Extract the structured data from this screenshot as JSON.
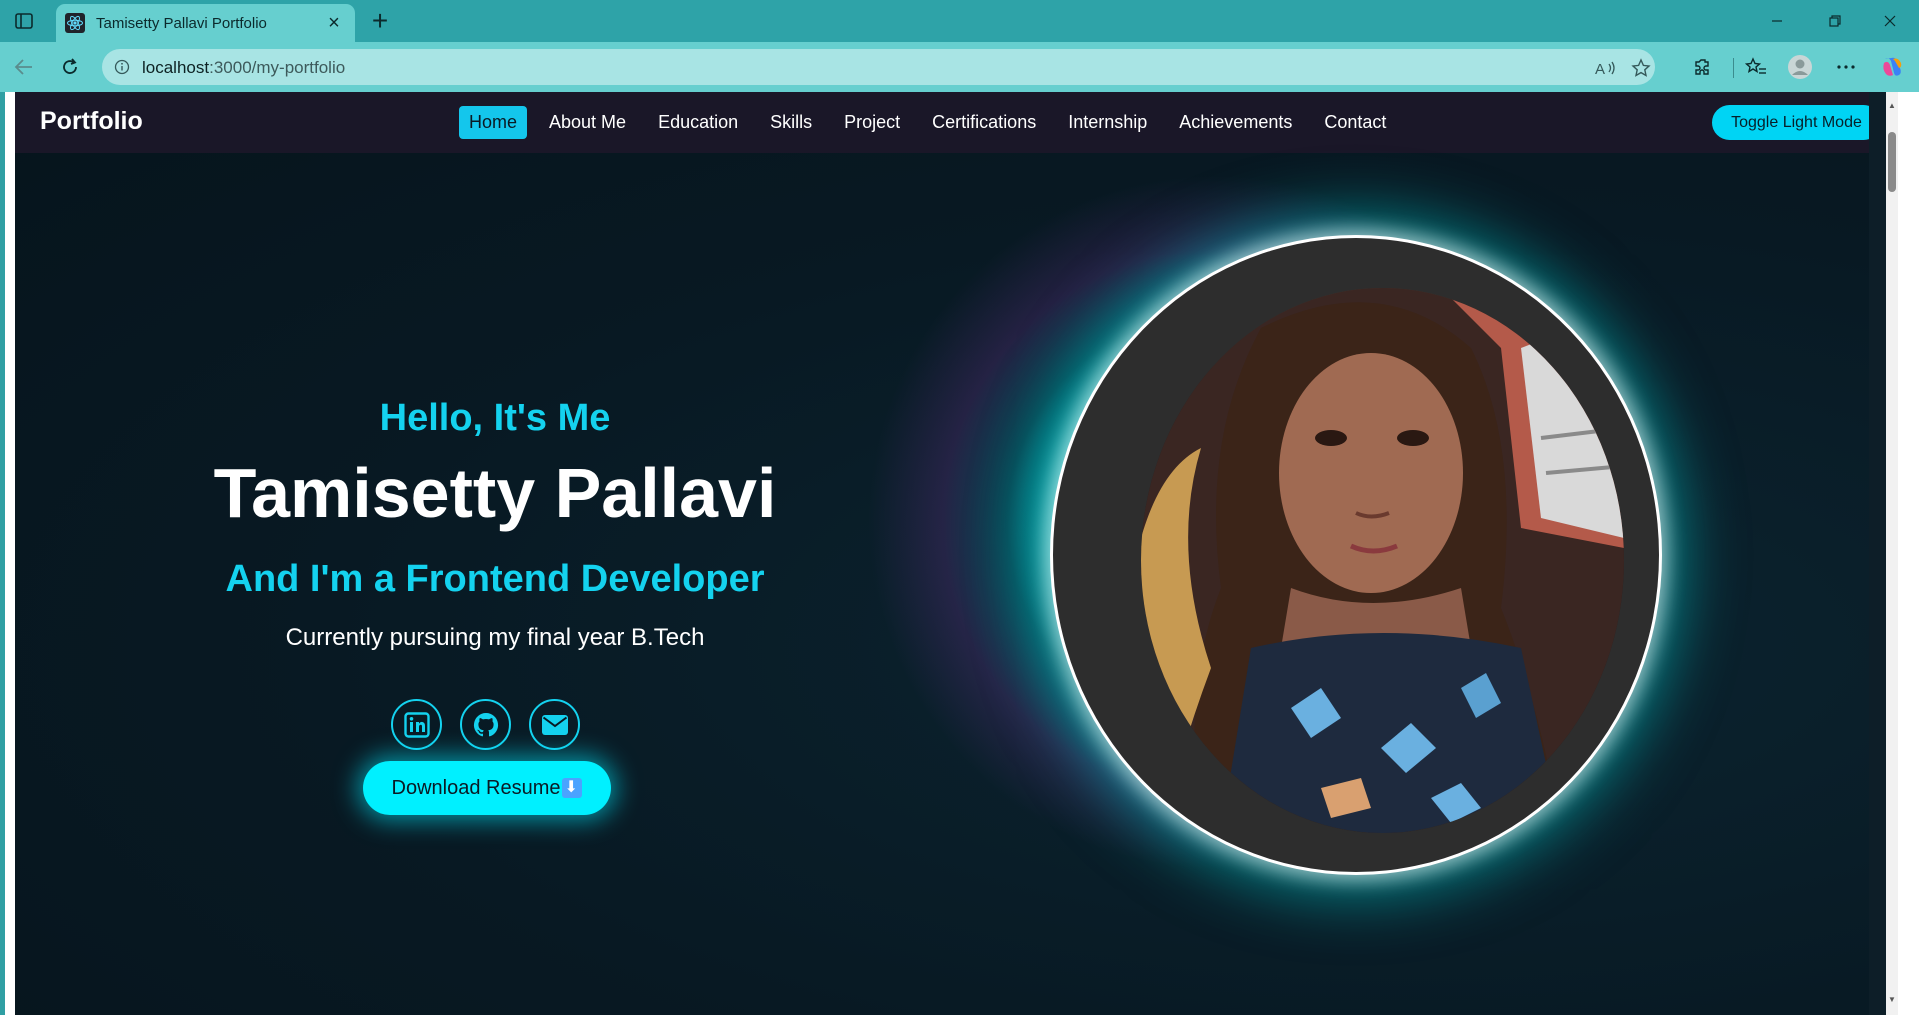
{
  "browser": {
    "tab_title": "Tamisetty Pallavi Portfolio",
    "url_host": "localhost",
    "url_path": ":3000/my-portfolio"
  },
  "nav": {
    "brand": "Portfolio",
    "links": [
      "Home",
      "About Me",
      "Education",
      "Skills",
      "Project",
      "Certifications",
      "Internship",
      "Achievements",
      "Contact"
    ],
    "active": "Home",
    "toggle_label": "Toggle Light Mode"
  },
  "hero": {
    "greeting": "Hello, It's Me",
    "name": "Tamisetty Pallavi",
    "role": "And I'm a Frontend Developer",
    "subtitle": "Currently pursuing my final year B.Tech",
    "socials": [
      "linkedin-icon",
      "github-icon",
      "email-icon"
    ],
    "resume_label": "Download Resume"
  },
  "colors": {
    "accent": "#14d2ef",
    "nav_bg": "#1a1728",
    "page_bg": "#081923",
    "button": "#00f0ff"
  }
}
